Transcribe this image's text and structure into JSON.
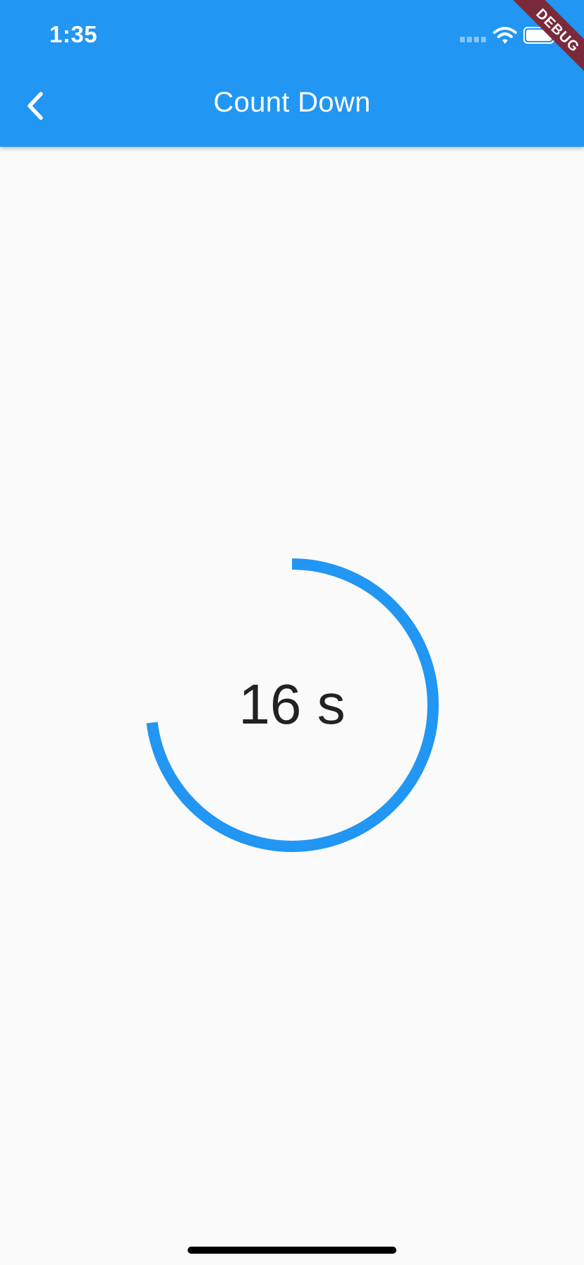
{
  "status_bar": {
    "time": "1:35"
  },
  "header": {
    "title": "Count Down",
    "back_icon": "chevron-left-icon"
  },
  "debug_banner": {
    "label": "DEBUG"
  },
  "timer": {
    "display": "16 s",
    "progress_fraction": 0.73
  },
  "colors": {
    "accent": "#2196f3",
    "banner": "#7b2a3c",
    "background": "#fafafa"
  }
}
